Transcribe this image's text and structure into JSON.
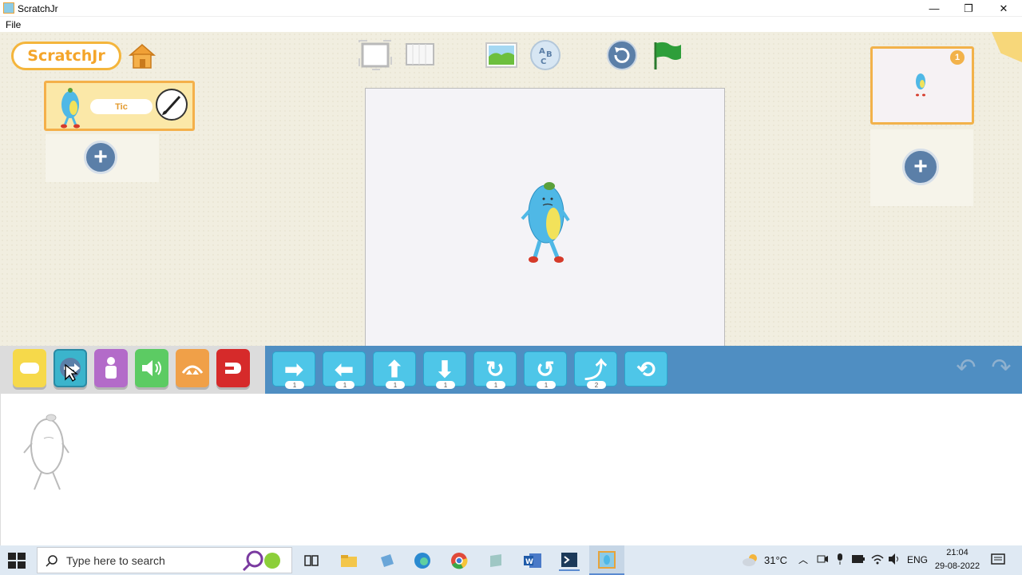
{
  "window": {
    "title": "ScratchJr",
    "minimize": "—",
    "maximize": "❐",
    "close": "✕"
  },
  "menubar": {
    "file": "File"
  },
  "header": {
    "logo_text": "ScratchJr"
  },
  "sprites": {
    "items": [
      {
        "name": "Tic"
      }
    ],
    "add_symbol": "+"
  },
  "pages": {
    "current": "1",
    "add_symbol": "+"
  },
  "colors": {
    "accent_orange": "#f4b04a",
    "palette_blue": "#4f8ec2",
    "motion_block": "#4ec6e8",
    "green_flag": "#2e9e3a"
  },
  "categories": [
    {
      "name": "triggering",
      "color": "#f6d94a"
    },
    {
      "name": "motion",
      "color": "#3bb4cc"
    },
    {
      "name": "looks",
      "color": "#b36bc9"
    },
    {
      "name": "sound",
      "color": "#5ccb63"
    },
    {
      "name": "control",
      "color": "#f0a048"
    },
    {
      "name": "end",
      "color": "#d62a2a"
    }
  ],
  "motion_blocks": [
    {
      "name": "move-right",
      "glyph": "➡",
      "value": "1"
    },
    {
      "name": "move-left",
      "glyph": "⬅",
      "value": "1"
    },
    {
      "name": "move-up",
      "glyph": "⬆",
      "value": "1"
    },
    {
      "name": "move-down",
      "glyph": "⬇",
      "value": "1"
    },
    {
      "name": "turn-right",
      "glyph": "↻",
      "value": "1"
    },
    {
      "name": "turn-left",
      "glyph": "↺",
      "value": "1"
    },
    {
      "name": "hop",
      "glyph": "⤴",
      "value": "2"
    },
    {
      "name": "go-home",
      "glyph": "⟲",
      "value": ""
    }
  ],
  "undo": "↶",
  "redo": "↷",
  "taskbar": {
    "search_placeholder": "Type here to search",
    "temperature": "31°C",
    "language": "ENG",
    "time": "21:04",
    "date": "29-08-2022"
  }
}
